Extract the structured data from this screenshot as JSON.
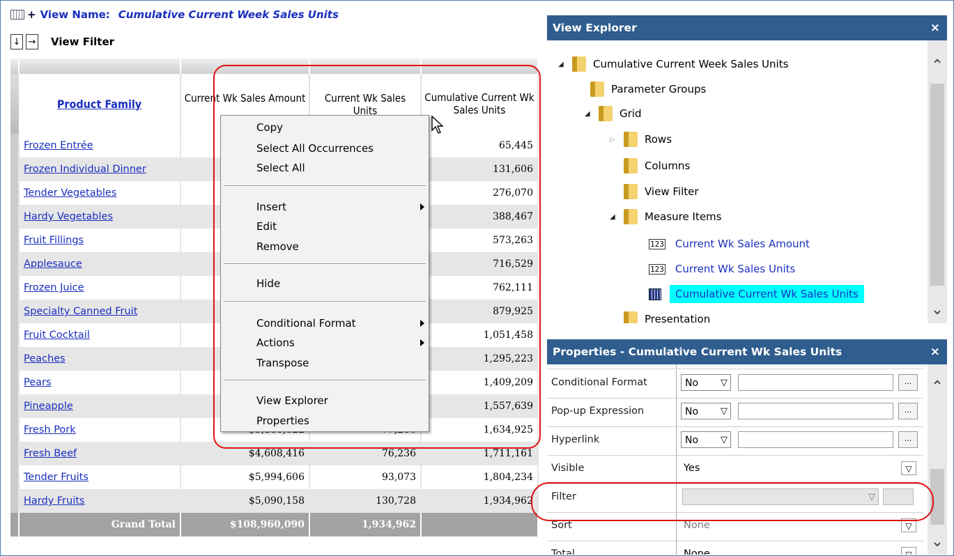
{
  "view": {
    "name_label": "View Name:",
    "name_value": "Cumulative Current Week Sales Units",
    "filter_label": "View Filter",
    "down_arrow": "↓",
    "right_arrow": "→",
    "plus": "+"
  },
  "grid": {
    "headers": [
      "Product Family",
      "Current Wk Sales Amount",
      "Current Wk Sales Units",
      "Cumulative Current Wk Sales Units"
    ],
    "rows": [
      {
        "name": "Frozen Entrée",
        "amount": "",
        "units": "",
        "cum": "65,445"
      },
      {
        "name": "Frozen Individual Dinner",
        "amount": "",
        "units": "",
        "cum": "131,606"
      },
      {
        "name": "Tender Vegetables",
        "amount": "",
        "units": "",
        "cum": "276,070"
      },
      {
        "name": "Hardy Vegetables",
        "amount": "",
        "units": "",
        "cum": "388,467"
      },
      {
        "name": "Fruit Fillings",
        "amount": "",
        "units": "",
        "cum": "573,263"
      },
      {
        "name": "Applesauce",
        "amount": "",
        "units": "",
        "cum": "716,529"
      },
      {
        "name": "Frozen Juice",
        "amount": "",
        "units": "",
        "cum": "762,111"
      },
      {
        "name": "Specialty Canned Fruit",
        "amount": "",
        "units": "",
        "cum": "879,925"
      },
      {
        "name": "Fruit Cocktail",
        "amount": "",
        "units": "",
        "cum": "1,051,458"
      },
      {
        "name": "Peaches",
        "amount": "",
        "units": "",
        "cum": "1,295,223"
      },
      {
        "name": "Pears",
        "amount": "",
        "units": "",
        "cum": "1,409,209"
      },
      {
        "name": "Pineapple",
        "amount": "",
        "units": "",
        "cum": "1,557,639"
      },
      {
        "name": "Fresh Pork",
        "amount": "$5,188,822",
        "units": "77,286",
        "cum": "1,634,925"
      },
      {
        "name": "Fresh Beef",
        "amount": "$4,608,416",
        "units": "76,236",
        "cum": "1,711,161"
      },
      {
        "name": "Tender Fruits",
        "amount": "$5,994,606",
        "units": "93,073",
        "cum": "1,804,234"
      },
      {
        "name": "Hardy Fruits",
        "amount": "$5,090,158",
        "units": "130,728",
        "cum": "1,934,962"
      }
    ],
    "total": {
      "label": "Grand Total",
      "amount": "$108,960,090",
      "units": "1,934,962",
      "cum": ""
    }
  },
  "context_menu": {
    "copy": "Copy",
    "select_all_occurrences": "Select All Occurrences",
    "select_all": "Select All",
    "insert": "Insert",
    "edit": "Edit",
    "remove": "Remove",
    "hide": "Hide",
    "conditional_format": "Conditional Format",
    "actions": "Actions",
    "transpose": "Transpose",
    "view_explorer": "View Explorer",
    "properties": "Properties"
  },
  "explorer": {
    "title": "View Explorer",
    "close": "×",
    "root": "Cumulative Current Week Sales Units",
    "parameter_groups": "Parameter Groups",
    "grid": "Grid",
    "rows": "Rows",
    "columns": "Columns",
    "view_filter": "View Filter",
    "measure_items": "Measure Items",
    "m1": "Current Wk Sales Amount",
    "m2": "Current Wk Sales Units",
    "m3": "Cumulative Current Wk Sales Units",
    "presentation": "Presentation",
    "icon_123": "123"
  },
  "properties": {
    "title": "Properties - Cumulative Current Wk Sales Units",
    "close": "×",
    "ellipsis": "...",
    "rows": [
      {
        "name": "Conditional Format",
        "value": "No"
      },
      {
        "name": "Pop-up Expression",
        "value": "No"
      },
      {
        "name": "Hyperlink",
        "value": "No"
      },
      {
        "name": "Visible",
        "value": "Yes"
      },
      {
        "name": "Filter",
        "value": ""
      },
      {
        "name": "Sort",
        "value": "None"
      },
      {
        "name": "Total",
        "value": "None"
      }
    ]
  },
  "colors": {
    "accent": "#2f5d8e",
    "link": "#1a2fbf",
    "highlight": "#00ffff",
    "annotation": "#e01010"
  }
}
